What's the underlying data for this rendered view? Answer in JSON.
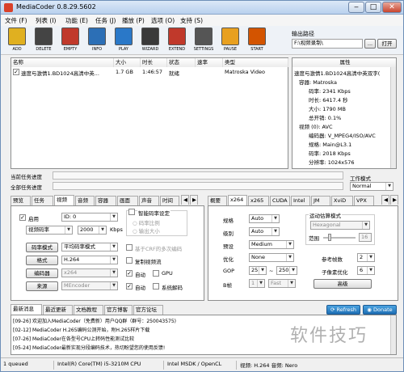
{
  "window": {
    "title": "MediaCoder 0.8.29.5602",
    "min": "‒",
    "max": "□",
    "close": "✕"
  },
  "menu": [
    "文件 (F)",
    "列表 (I)",
    "功能 (E)",
    "任务 (J)",
    "播放 (P)",
    "选项 (O)",
    "支持 (S)"
  ],
  "toolbar": [
    {
      "label": "ADD",
      "color": "#e0b020",
      "icon": "add-icon"
    },
    {
      "label": "DELETE",
      "color": "#444444",
      "icon": "delete-icon"
    },
    {
      "label": "EMPTY",
      "color": "#c0392b",
      "icon": "empty-icon"
    },
    {
      "label": "INFO",
      "color": "#2c6fb6",
      "icon": "info-icon"
    },
    {
      "label": "PLAY",
      "color": "#2a78c8",
      "icon": "play-icon"
    },
    {
      "label": "WIZARD",
      "color": "#3a3a3a",
      "icon": "wizard-icon"
    },
    {
      "label": "EXTEND",
      "color": "#c0392b",
      "icon": "extend-icon"
    },
    {
      "label": "SETTINGS",
      "color": "#555555",
      "icon": "settings-icon"
    },
    {
      "label": "PAUSE",
      "color": "#e8a020",
      "icon": "pause-icon"
    },
    {
      "label": "START",
      "color": "#d35400",
      "icon": "start-icon"
    }
  ],
  "output": {
    "label": "输出路径",
    "path": "F:\\视频录制\\",
    "browse": "...",
    "open": "打开"
  },
  "filelist": {
    "headers": [
      "名称",
      "大小",
      "时长",
      "状态",
      "速率",
      "类型"
    ],
    "rows": [
      {
        "name": "速度与激情1.BD1024高清中英...",
        "size": "1.7 GB",
        "duration": "1:46:57",
        "status": "就绪",
        "rate": "",
        "type": "Matroska Video"
      }
    ]
  },
  "properties": {
    "header": "属性",
    "items": [
      "速度与激情1.BD1024高清中英双字(",
      "容器: Matroska",
      "码率: 2341 Kbps",
      "时长: 6417.4 秒",
      "大小: 1790 MB",
      "总开销: 0.1%",
      "视频 (0): AVC",
      "编码器: V_MPEG4/ISO/AVC",
      "规格: Main@L3.1",
      "码率: 2018 Kbps",
      "分辨率: 1024x576"
    ]
  },
  "progress": {
    "current": "当前任务进度",
    "total": "全部任务进度"
  },
  "work_mode": {
    "label": "工作模式",
    "value": "Normal"
  },
  "left_tabs": [
    "预览",
    "任务",
    "视频",
    "音频",
    "容器",
    "画面",
    "声音",
    "时间"
  ],
  "video": {
    "enable": "启用",
    "id_value": "ID: 0",
    "rate_mode": "视频码率",
    "bitrate": "2000",
    "kbps": "Kbps",
    "smart_group": "智能码率设定",
    "opt1": "码率比例",
    "opt2": "输出大小",
    "crf": "基于CRF的多次编码",
    "rate_mode_btn": "码率模式",
    "rate_mode_value": "平均码率模式",
    "format_btn": "格式",
    "format_value": "H.264",
    "copy": "复制视频流",
    "encoder_btn": "编码器",
    "encoder_value": "x264",
    "auto": "自动",
    "gpu": "GPU",
    "source_btn": "来源",
    "source_value": "MEncoder",
    "auto2": "自动",
    "sysdecode": "系统解码"
  },
  "right_tabs": [
    "概要",
    "x264",
    "x265",
    "CUDA",
    "Intel",
    "JM",
    "XviD",
    "VPX"
  ],
  "x264": {
    "profile_label": "规格",
    "profile": "Auto",
    "level_label": "级别",
    "level": "Auto",
    "preset_label": "预设",
    "preset": "Medium",
    "tune_label": "优化",
    "tune": "None",
    "gop_label": "GOP",
    "gop_min": "25",
    "gop_sep": "~",
    "gop_max": "250",
    "bframe_label": "B帧",
    "bframe": "1",
    "bframe_mode": "Fast",
    "me_group": "运动估算模式",
    "me": "Hexagonal",
    "range_label": "范围",
    "range": "16",
    "ref_label": "参考帧数",
    "ref": "2",
    "subme_label": "子像素优化",
    "subme": "6",
    "adv": "高级"
  },
  "news": {
    "tabs": [
      "最新消息",
      "最近更新",
      "文档教程",
      "官方博客",
      "官方论坛"
    ],
    "items": [
      "[09-26] 欢迎加入MediaCoder（免费新）用户QQ群（群号：250043575)",
      "[02-12] MediaCoder H.265编码公测开始，附H.265样片下载",
      "[07-26] MediaCoder在各型号CPU上转码性能测试比较",
      "[05-24] MediaCoder最新实现分段编码技术，热切盼望您的使用反馈!"
    ],
    "refresh": "Refresh",
    "donate": "Donate"
  },
  "statusbar": [
    "1 queued",
    "Intel(R) Core(TM) i5-3210M CPU",
    "Intel MSDK / OpenCL",
    "视频: H.264 音频: Nero"
  ],
  "watermark": "软件技巧"
}
